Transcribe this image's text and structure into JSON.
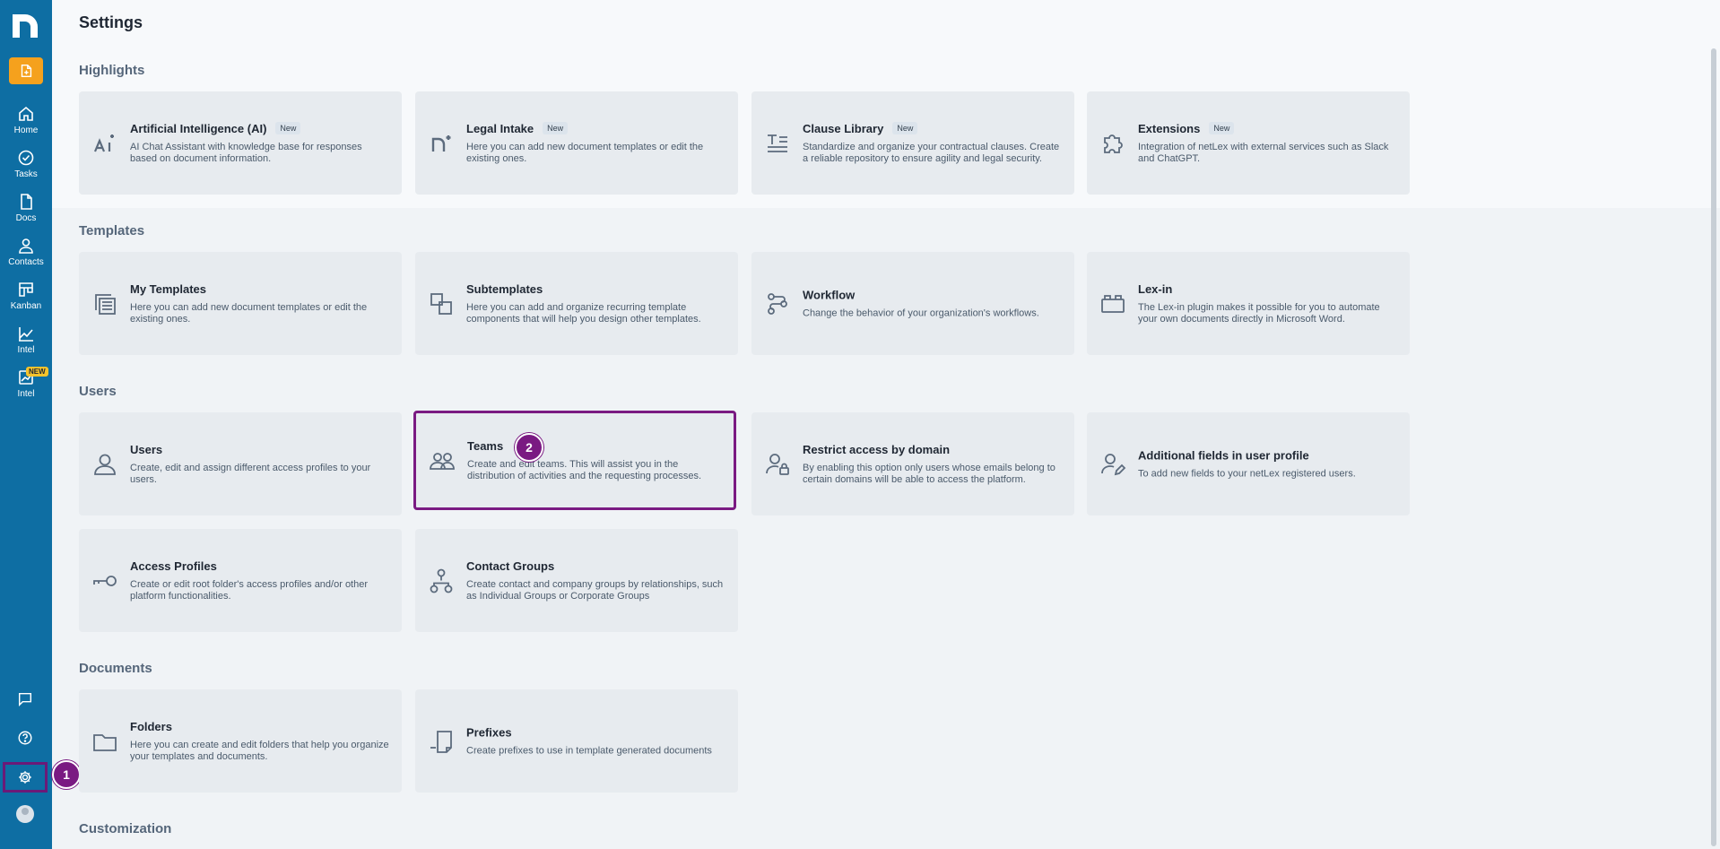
{
  "page": {
    "title": "Settings"
  },
  "sidebar": {
    "items": [
      {
        "label": "Home",
        "icon": "home-icon"
      },
      {
        "label": "Tasks",
        "icon": "check-circle-icon"
      },
      {
        "label": "Docs",
        "icon": "document-icon"
      },
      {
        "label": "Contacts",
        "icon": "person-icon"
      },
      {
        "label": "Kanban",
        "icon": "kanban-icon"
      },
      {
        "label": "Intel",
        "icon": "chart-icon"
      },
      {
        "label": "Intel",
        "icon": "chart-new-icon",
        "badge": "NEW"
      }
    ],
    "bottom_icons": [
      "chat-icon",
      "help-icon",
      "gear-icon",
      "avatar"
    ]
  },
  "steps": {
    "one": "1",
    "two": "2"
  },
  "sections": {
    "highlights": {
      "title": "Highlights",
      "cards": [
        {
          "title": "Artificial Intelligence (AI)",
          "badge": "New",
          "desc": "AI Chat Assistant with knowledge base for responses based on document information."
        },
        {
          "title": "Legal Intake",
          "badge": "New",
          "desc": "Here you can add new document templates or edit the existing ones."
        },
        {
          "title": "Clause Library",
          "badge": "New",
          "desc": "Standardize and organize your contractual clauses. Create a reliable repository to ensure agility and legal security."
        },
        {
          "title": "Extensions",
          "badge": "New",
          "desc": "Integration of netLex with external services such as Slack and ChatGPT."
        }
      ]
    },
    "templates": {
      "title": "Templates",
      "cards": [
        {
          "title": "My Templates",
          "desc": "Here you can add new document templates or edit the existing ones."
        },
        {
          "title": "Subtemplates",
          "desc": "Here you can add and organize recurring template components that will help you design other templates."
        },
        {
          "title": "Workflow",
          "desc": "Change the behavior of your organization's workflows."
        },
        {
          "title": "Lex-in",
          "desc": "The Lex-in plugin makes it possible for you to automate your own documents directly in Microsoft Word."
        }
      ]
    },
    "users": {
      "title": "Users",
      "cards": [
        {
          "title": "Users",
          "desc": "Create, edit and assign different access profiles to your users."
        },
        {
          "title": "Teams",
          "desc": "Create and edit teams. This will assist you in the distribution of activities and the requesting processes."
        },
        {
          "title": "Restrict access by domain",
          "desc": "By enabling this option only users whose emails belong to certain domains will be able to access the platform."
        },
        {
          "title": "Additional fields in user profile",
          "desc": "To add new fields to your netLex registered users."
        },
        {
          "title": "Access Profiles",
          "desc": "Create or edit root folder's access profiles and/or other platform functionalities."
        },
        {
          "title": "Contact Groups",
          "desc": "Create contact and company groups by relationships, such as Individual Groups or Corporate Groups"
        }
      ]
    },
    "documents": {
      "title": "Documents",
      "cards": [
        {
          "title": "Folders",
          "desc": "Here you can create and edit folders that help you organize your templates and documents."
        },
        {
          "title": "Prefixes",
          "desc": "Create prefixes to use in template generated documents"
        }
      ]
    },
    "customization": {
      "title": "Customization"
    }
  },
  "colors": {
    "sidebar": "#0e6ea3",
    "accent": "#f5a11d",
    "highlight_border": "#7a1a82"
  }
}
